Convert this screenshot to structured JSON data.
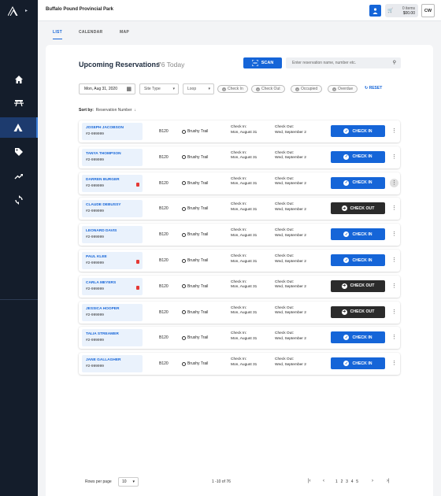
{
  "app": {
    "park_name": "Buffalo Pound Provincial Park",
    "cart_items": "0 items",
    "cart_total": "$00.00",
    "user_initials": "CW"
  },
  "tabs": [
    "LIST",
    "CALENDAR",
    "MAP"
  ],
  "header": {
    "title": "Upcoming Reservations",
    "count": "76 Today",
    "scan_label": "SCAN",
    "search_placeholder": "Enter reservation name, number etc."
  },
  "filters": {
    "date": "Mon, Aug 31, 2020",
    "site_type": "Site Type",
    "loop": "Loop",
    "chips": [
      "Check In",
      "Check Out",
      "Occupied",
      "Overdue"
    ],
    "reset": "RESET"
  },
  "sort": {
    "label": "Sort by:",
    "value": "Reservation Number"
  },
  "rows": [
    {
      "name": "JOSEPH JACOBSON",
      "id": "#2-999999",
      "site": "B120",
      "loop": "Brushy Trail",
      "ci_label": "Check In:",
      "ci_date": "Mon, August 31",
      "co_label": "Check Out:",
      "co_date": "Wed, September 2",
      "action": "CHECK IN",
      "alert": false
    },
    {
      "name": "TANYA THOMPSON",
      "id": "#2-999999",
      "site": "B120",
      "loop": "Brushy Trail",
      "ci_label": "Check In:",
      "ci_date": "Mon, August 31",
      "co_label": "Check Out:",
      "co_date": "Wed, September 2",
      "action": "CHECK IN",
      "alert": false
    },
    {
      "name": "DARREN BURGER",
      "id": "#2-999999",
      "site": "B120",
      "loop": "Brushy Trail",
      "ci_label": "Check In:",
      "ci_date": "Mon, August 31",
      "co_label": "Check Out:",
      "co_date": "Wed, September 2",
      "action": "CHECK IN",
      "alert": true
    },
    {
      "name": "CLAUDE DEBUSSY",
      "id": "#2-999999",
      "site": "B120",
      "loop": "Brushy Trail",
      "ci_label": "Check In:",
      "ci_date": "Mon, August 31",
      "co_label": "Check Out:",
      "co_date": "Wed, September 2",
      "action": "CHECK OUT",
      "alert": false
    },
    {
      "name": "LEONARD DAVIS",
      "id": "#2-999999",
      "site": "B120",
      "loop": "Brushy Trail",
      "ci_label": "Check In:",
      "ci_date": "Mon, August 31",
      "co_label": "Check Out:",
      "co_date": "Wed, September 2",
      "action": "CHECK IN",
      "alert": false
    },
    {
      "name": "PAUL KLEE",
      "id": "#2-999999",
      "site": "B120",
      "loop": "Brushy Trail",
      "ci_label": "Check In:",
      "ci_date": "Mon, August 31",
      "co_label": "Check Out:",
      "co_date": "Wed, September 2",
      "action": "CHECK IN",
      "alert": true
    },
    {
      "name": "CARLA MEYERS",
      "id": "#2-999999",
      "site": "B120",
      "loop": "Brushy Trail",
      "ci_label": "Check In:",
      "ci_date": "Mon, August 31",
      "co_label": "Check Out:",
      "co_date": "Wed, September 2",
      "action": "CHECK OUT",
      "alert": true
    },
    {
      "name": "JESSICA HOOPER",
      "id": "#2-999999",
      "site": "B120",
      "loop": "Brushy Trail",
      "ci_label": "Check In:",
      "ci_date": "Mon, August 31",
      "co_label": "Check Out:",
      "co_date": "Wed, September 2",
      "action": "CHECK OUT",
      "alert": false
    },
    {
      "name": "TALIA STREAMER",
      "id": "#2-999999",
      "site": "B120",
      "loop": "Brushy Trail",
      "ci_label": "Check In:",
      "ci_date": "Mon, August 31",
      "co_label": "Check Out:",
      "co_date": "Wed, September 2",
      "action": "CHECK IN",
      "alert": false
    },
    {
      "name": "JANE GALLAGHER",
      "id": "#2-999999",
      "site": "B120",
      "loop": "Brushy Trail",
      "ci_label": "Check In:",
      "ci_date": "Mon, August 31",
      "co_label": "Check Out:",
      "co_date": "Wed, September 2",
      "action": "CHECK IN",
      "alert": false
    }
  ],
  "pagination": {
    "rows_label": "Rows per page",
    "rows_value": "10",
    "range": "1 -10 of 76",
    "pages": "1 2 3 4 5"
  },
  "colors": {
    "primary": "#1565d8",
    "sidebar": "#141d2b",
    "dark_button": "#2b2b2b",
    "alert": "#e53935"
  },
  "icons": [
    "logo-icon",
    "home-icon",
    "picnic-table-icon",
    "tent-icon",
    "tag-icon",
    "trending-icon",
    "sync-icon",
    "person-icon",
    "cart-icon",
    "scan-icon",
    "search-icon",
    "calendar-icon",
    "check-icon",
    "arrow-right-icon",
    "more-vertical-icon"
  ]
}
